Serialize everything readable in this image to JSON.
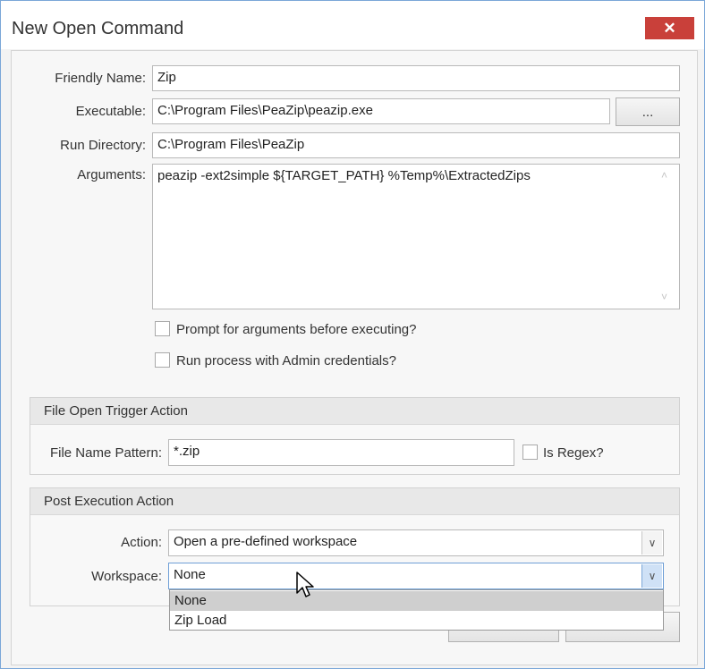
{
  "window": {
    "title": "New Open Command",
    "close_glyph": "✕"
  },
  "form": {
    "friendly_name_label": "Friendly Name:",
    "friendly_name_value": "Zip",
    "executable_label": "Executable:",
    "executable_value": "C:\\Program Files\\PeaZip\\peazip.exe",
    "browse_label": "...",
    "run_directory_label": "Run Directory:",
    "run_directory_value": "C:\\Program Files\\PeaZip",
    "arguments_label": "Arguments:",
    "arguments_value": "peazip -ext2simple ${TARGET_PATH} %Temp%\\ExtractedZips",
    "prompt_checkbox_label": "Prompt for arguments before executing?",
    "prompt_checked": false,
    "admin_checkbox_label": "Run process with Admin credentials?",
    "admin_checked": false
  },
  "trigger_group": {
    "header": "File Open Trigger Action",
    "pattern_label": "File Name Pattern:",
    "pattern_value": "*.zip",
    "regex_label": "Is Regex?",
    "regex_checked": false
  },
  "post_group": {
    "header": "Post Execution Action",
    "action_label": "Action:",
    "action_value": "Open a pre-defined workspace",
    "workspace_label": "Workspace:",
    "workspace_value": "None",
    "workspace_options": [
      "None",
      "Zip Load"
    ],
    "workspace_highlighted": "None"
  },
  "icons": {
    "close": "close-icon",
    "combo_arrow": "chevron-down-icon",
    "scroll_up": "chevron-up-icon",
    "scroll_down": "chevron-down-icon",
    "cursor": "mouse-pointer-icon"
  },
  "colors": {
    "close_button": "#c9403a",
    "window_border": "#7aa7d8",
    "dropdown_highlight": "#cfcfcf",
    "active_combo_arrow": "#cfe1f6"
  }
}
